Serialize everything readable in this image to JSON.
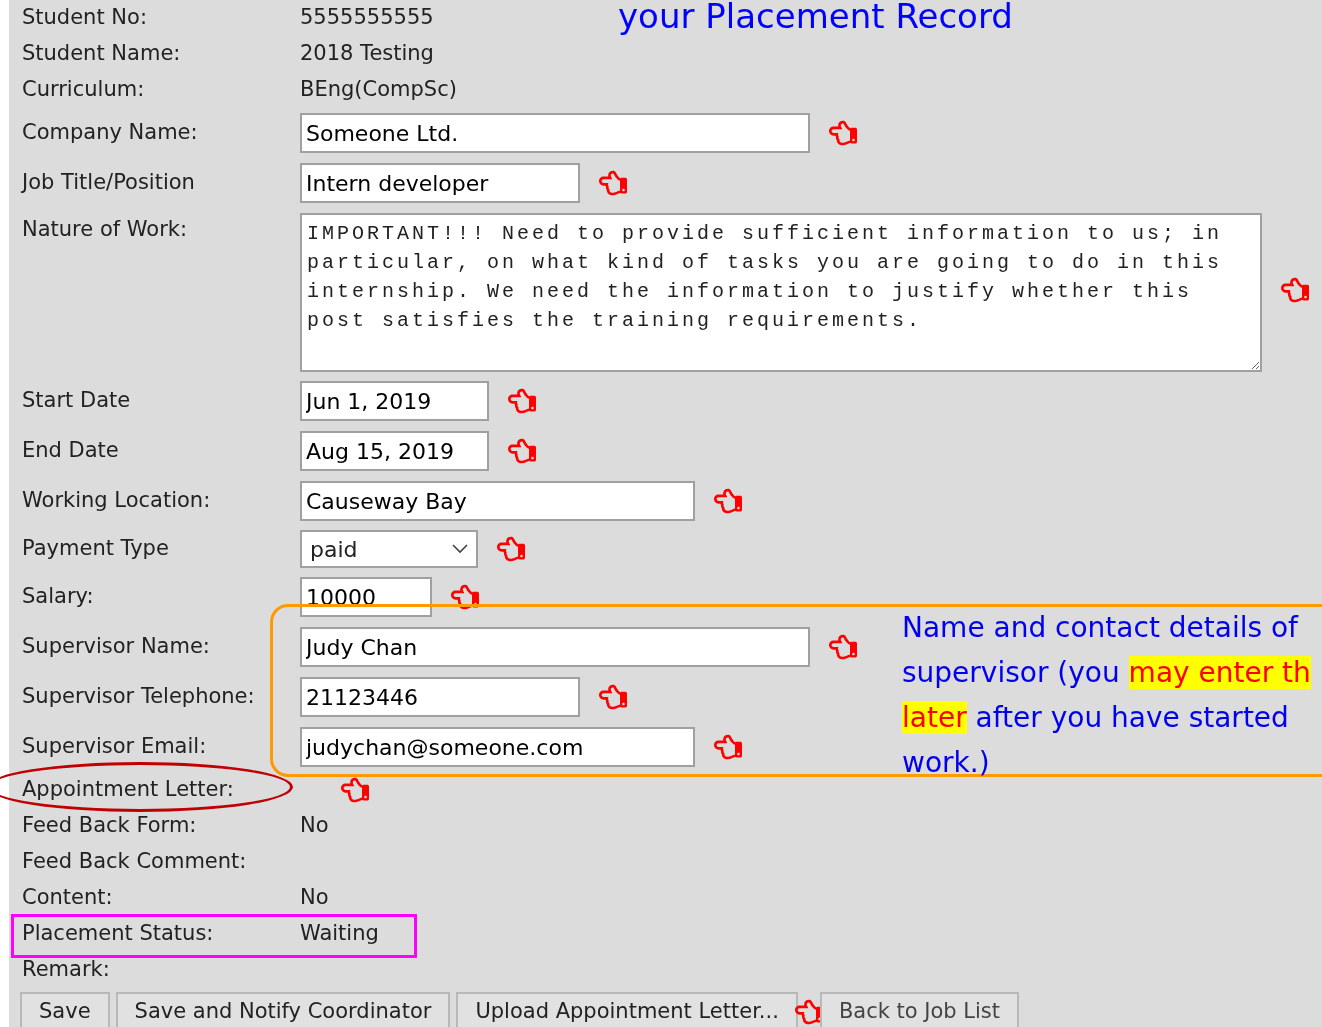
{
  "title": "your Placement Record",
  "fields": [
    {
      "label": "Student No:",
      "kind": "text",
      "value": "5555555555",
      "pointer": false
    },
    {
      "label": "Student Name:",
      "kind": "text",
      "value": "2018 Testing",
      "pointer": false
    },
    {
      "label": "Curriculum:",
      "kind": "text",
      "value": "BEng(CompSc)",
      "pointer": false
    },
    {
      "label": "Company Name:",
      "kind": "input",
      "value": "Someone Ltd.",
      "pointer": true
    },
    {
      "label": "Job Title/Position",
      "kind": "input",
      "value": "Intern developer",
      "pointer": true
    },
    {
      "label": "Nature of Work:",
      "kind": "textarea",
      "value": "IMPORTANT!!! Need to provide sufficient information to us; in particular, on what kind of tasks you are going to do in this internship. We need the information to justify whether this post satisfies the training requirements.",
      "pointer": true
    },
    {
      "label": "Start Date",
      "kind": "input",
      "value": "Jun 1, 2019",
      "pointer": true
    },
    {
      "label": "End Date",
      "kind": "input",
      "value": "Aug 15, 2019",
      "pointer": true
    },
    {
      "label": "Working Location:",
      "kind": "input",
      "value": "Causeway Bay",
      "pointer": true
    },
    {
      "label": "Payment Type",
      "kind": "select",
      "value": "paid",
      "pointer": true
    },
    {
      "label": "Salary:",
      "kind": "input",
      "value": "10000",
      "pointer": true
    },
    {
      "label": "Supervisor Name:",
      "kind": "input",
      "value": "Judy Chan",
      "pointer": true
    },
    {
      "label": "Supervisor Telephone:",
      "kind": "input",
      "value": "21123446",
      "pointer": true
    },
    {
      "label": "Supervisor Email:",
      "kind": "input",
      "value": "judychan@someone.com",
      "pointer": true
    },
    {
      "label": "Appointment Letter:",
      "kind": "none",
      "pointer": true
    },
    {
      "label": "Feed Back Form:",
      "kind": "text",
      "value": "No",
      "pointer": false
    },
    {
      "label": "Feed Back Comment:",
      "kind": "none",
      "pointer": false
    },
    {
      "label": "Content:",
      "kind": "text",
      "value": "No",
      "pointer": false
    },
    {
      "label": "Placement Status:",
      "kind": "text",
      "value": "Waiting",
      "pointer": false
    },
    {
      "label": "Remark:",
      "kind": "none",
      "pointer": false
    }
  ],
  "note": [
    [
      {
        "text": "Name and contact details of",
        "highlight": false
      }
    ],
    [
      {
        "text": "supervisor (you ",
        "highlight": false
      },
      {
        "text": "may enter th",
        "highlight": true
      }
    ],
    [
      {
        "text": "later",
        "highlight": true
      },
      {
        "text": " after you have started",
        "highlight": false
      }
    ],
    [
      {
        "text": "work.)",
        "highlight": false
      }
    ]
  ],
  "buttons": [
    {
      "label": "Save",
      "pointer": false
    },
    {
      "label": "Save and Notify Coordinator",
      "pointer": false
    },
    {
      "label": "Upload Appointment Letter...",
      "pointer": true
    },
    {
      "label": "Back to Job List",
      "pointer": false
    }
  ]
}
